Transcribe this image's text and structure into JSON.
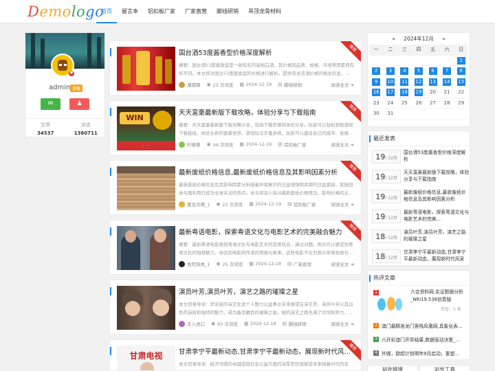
{
  "header": {
    "logo": [
      "D",
      "emo",
      "lo",
      "go"
    ],
    "nav": [
      {
        "label": "首页",
        "active": true
      },
      {
        "label": "留言本",
        "active": false
      },
      {
        "label": "铝扣板厂家",
        "active": false
      },
      {
        "label": "厂家直营",
        "active": false
      },
      {
        "label": "脚线研销",
        "active": false
      },
      {
        "label": "吊顶龙骨材料",
        "active": false
      }
    ]
  },
  "profile": {
    "username": "admin",
    "vip": "游客",
    "stats": [
      {
        "label": "文章",
        "value": "34537"
      },
      {
        "label": "浏览",
        "value": "1360711"
      }
    ]
  },
  "articles": [
    {
      "title": "国台酒53度酱香型价格深度解析",
      "excerpt": "摘要：国台酒53度酱香型是一款知名的高档白酒，其价格因品牌、规格、市场等因素而有所不同。本文将对国台53度酱香型的价格进行解析，提供有关该酒价格的相关信息，...",
      "author": "潘朋钢",
      "views": "23 次浏览",
      "date": "2024-12-19",
      "category": "脚线研销",
      "readmore": "阅读全文",
      "ribbon": "推荐"
    },
    {
      "title": "天天富豪最新版下载攻略，体验分享与下载指南",
      "excerpt": "摘要：天天富豪最新版下载攻略分享，包括下载步骤和体验分享。玩家可以轻松获取游戏下载链接，体验全新的富豪世界。游戏玩法丰富多样，玩家可以建设自己的城市、发展...",
      "author": "柠檬黄",
      "views": "44 次浏览",
      "date": "2024-12-19",
      "category": "铝扣板厂家",
      "readmore": "阅读全文",
      "ribbon": "推荐"
    },
    {
      "title": "最新废纸价格信息,最新废纸价格信息及其影响因素分析",
      "excerpt": "最新废纸价格信息及其影响因素分析随着环保意识的日益增强和资源的日益紧缺，废纸回收与再利用已成为全球关注的热点。本文将深入探讨最新废纸价格情况，影响价格的主...",
      "author": "喜龙点晴_1",
      "views": "22 次浏览",
      "date": "2024-12-19",
      "category": "铝扣板厂家",
      "readmore": "阅读全文",
      "ribbon": "推荐"
    },
    {
      "title": "最新粤语电影，探索粤语文化与电影艺术的完美融合魅力",
      "excerpt": "摘要：最新粤语电影展现粤语文化与电影艺术的完美结合，通过对题。观众可以感受到粤语文化的独特魅力，体验到电影所传递的情感与故事。这些电影不仅为观众带来视觉与...",
      "author": "免死狗类_1",
      "views": "25 次浏览",
      "date": "2024-12-18",
      "category": "厂家直营",
      "readmore": "阅读全文",
      "ribbon": "推荐"
    },
    {
      "title": "演员叶芳,演员叶芳，演艺之路的璀璨之星",
      "excerpt": "本文目录导读：早年经历演艺生涯个人魅力公益事业未来展望在演艺界，演员叶芳以其出色的演技和独特的魅力，成为备受瞩目的璀璨之星。她的演艺之路充满了坎坷和努力，...",
      "author": "丰入虎口",
      "views": "93 次浏览",
      "date": "2024-12-18",
      "category": "脚线研销",
      "readmore": "阅读全文",
      "ribbon": ""
    },
    {
      "title": "甘肃李宁平最新动态,甘肃李宁平最新动态，展现新时代风采与...",
      "excerpt": "本文目录导读：经济领域的卓越成就社会公益方面的深厚责任感展望未来随着时代的变迁，甘肃李宁平在新时代的舞台上...",
      "author": "",
      "views": "",
      "date": "",
      "category": "",
      "readmore": "",
      "ribbon": "推荐"
    }
  ],
  "calendar": {
    "prev": "«",
    "title": "2024年12月",
    "next": "»",
    "weekdays": [
      "一",
      "二",
      "三",
      "四",
      "五",
      "六",
      "日"
    ],
    "days": [
      "",
      "",
      "",
      "",
      "",
      "",
      "1",
      "2",
      "3",
      "4",
      "5",
      "6",
      "7",
      "8",
      "9",
      "10",
      "11",
      "12",
      "13",
      "14",
      "15",
      "16",
      "17",
      "18",
      "19",
      "20",
      "21",
      "22",
      "23",
      "24",
      "25",
      "26",
      "27",
      "28",
      "29",
      "30",
      "31",
      "",
      "",
      "",
      "",
      ""
    ],
    "linked": [
      "1",
      "2",
      "3",
      "4",
      "5",
      "6",
      "7",
      "8",
      "9",
      "10",
      "11",
      "12",
      "13",
      "14",
      "15",
      "16",
      "17",
      "18",
      "19"
    ]
  },
  "recent": {
    "title": "最近发表",
    "items": [
      {
        "day": "19",
        "month": "/ 12月",
        "title": "国台酒53度酱香型价格深度解析"
      },
      {
        "day": "19",
        "month": "/ 12月",
        "title": "天天富豪最新版下载攻略，体验分享与下载指南"
      },
      {
        "day": "19",
        "month": "/ 12月",
        "title": "最新废纸价格信息,最新废纸价格信息及其影响因素分析"
      },
      {
        "day": "19",
        "month": "/ 12月",
        "title": "最新粤语电影，探索粤语文化与电影艺术的完美..."
      },
      {
        "day": "18",
        "month": "/ 12月",
        "title": "演员叶芳,演员叶芳，演艺之路的璀璨之星"
      },
      {
        "day": "18",
        "month": "/ 12月",
        "title": "甘肃李宁平最新动态,甘肃李宁平最新动态，展现新时代风采"
      }
    ]
  },
  "hot": {
    "title": "热评文章",
    "featured": {
      "title": "六合资料网,实证数据分析_NRI19.538创意版",
      "comments": "评论：5 条"
    },
    "items": [
      {
        "rank": "2",
        "title": "澳门最精准龙门客栈风凰网,具象化表..."
      },
      {
        "rank": "3",
        "title": "六开彩澳门开奖结果,数据驱动决策_..."
      },
      {
        "rank": "4",
        "title": "外媒，欧超计划明年9月启动，重塑..."
      }
    ]
  },
  "bottom_tabs": [
    "站外链接",
    "站长工具"
  ],
  "colors": {
    "accent": "#1e88e5",
    "ribbon": "#d9342b",
    "wechat": "#44b549",
    "qq": "#f15b5b"
  }
}
